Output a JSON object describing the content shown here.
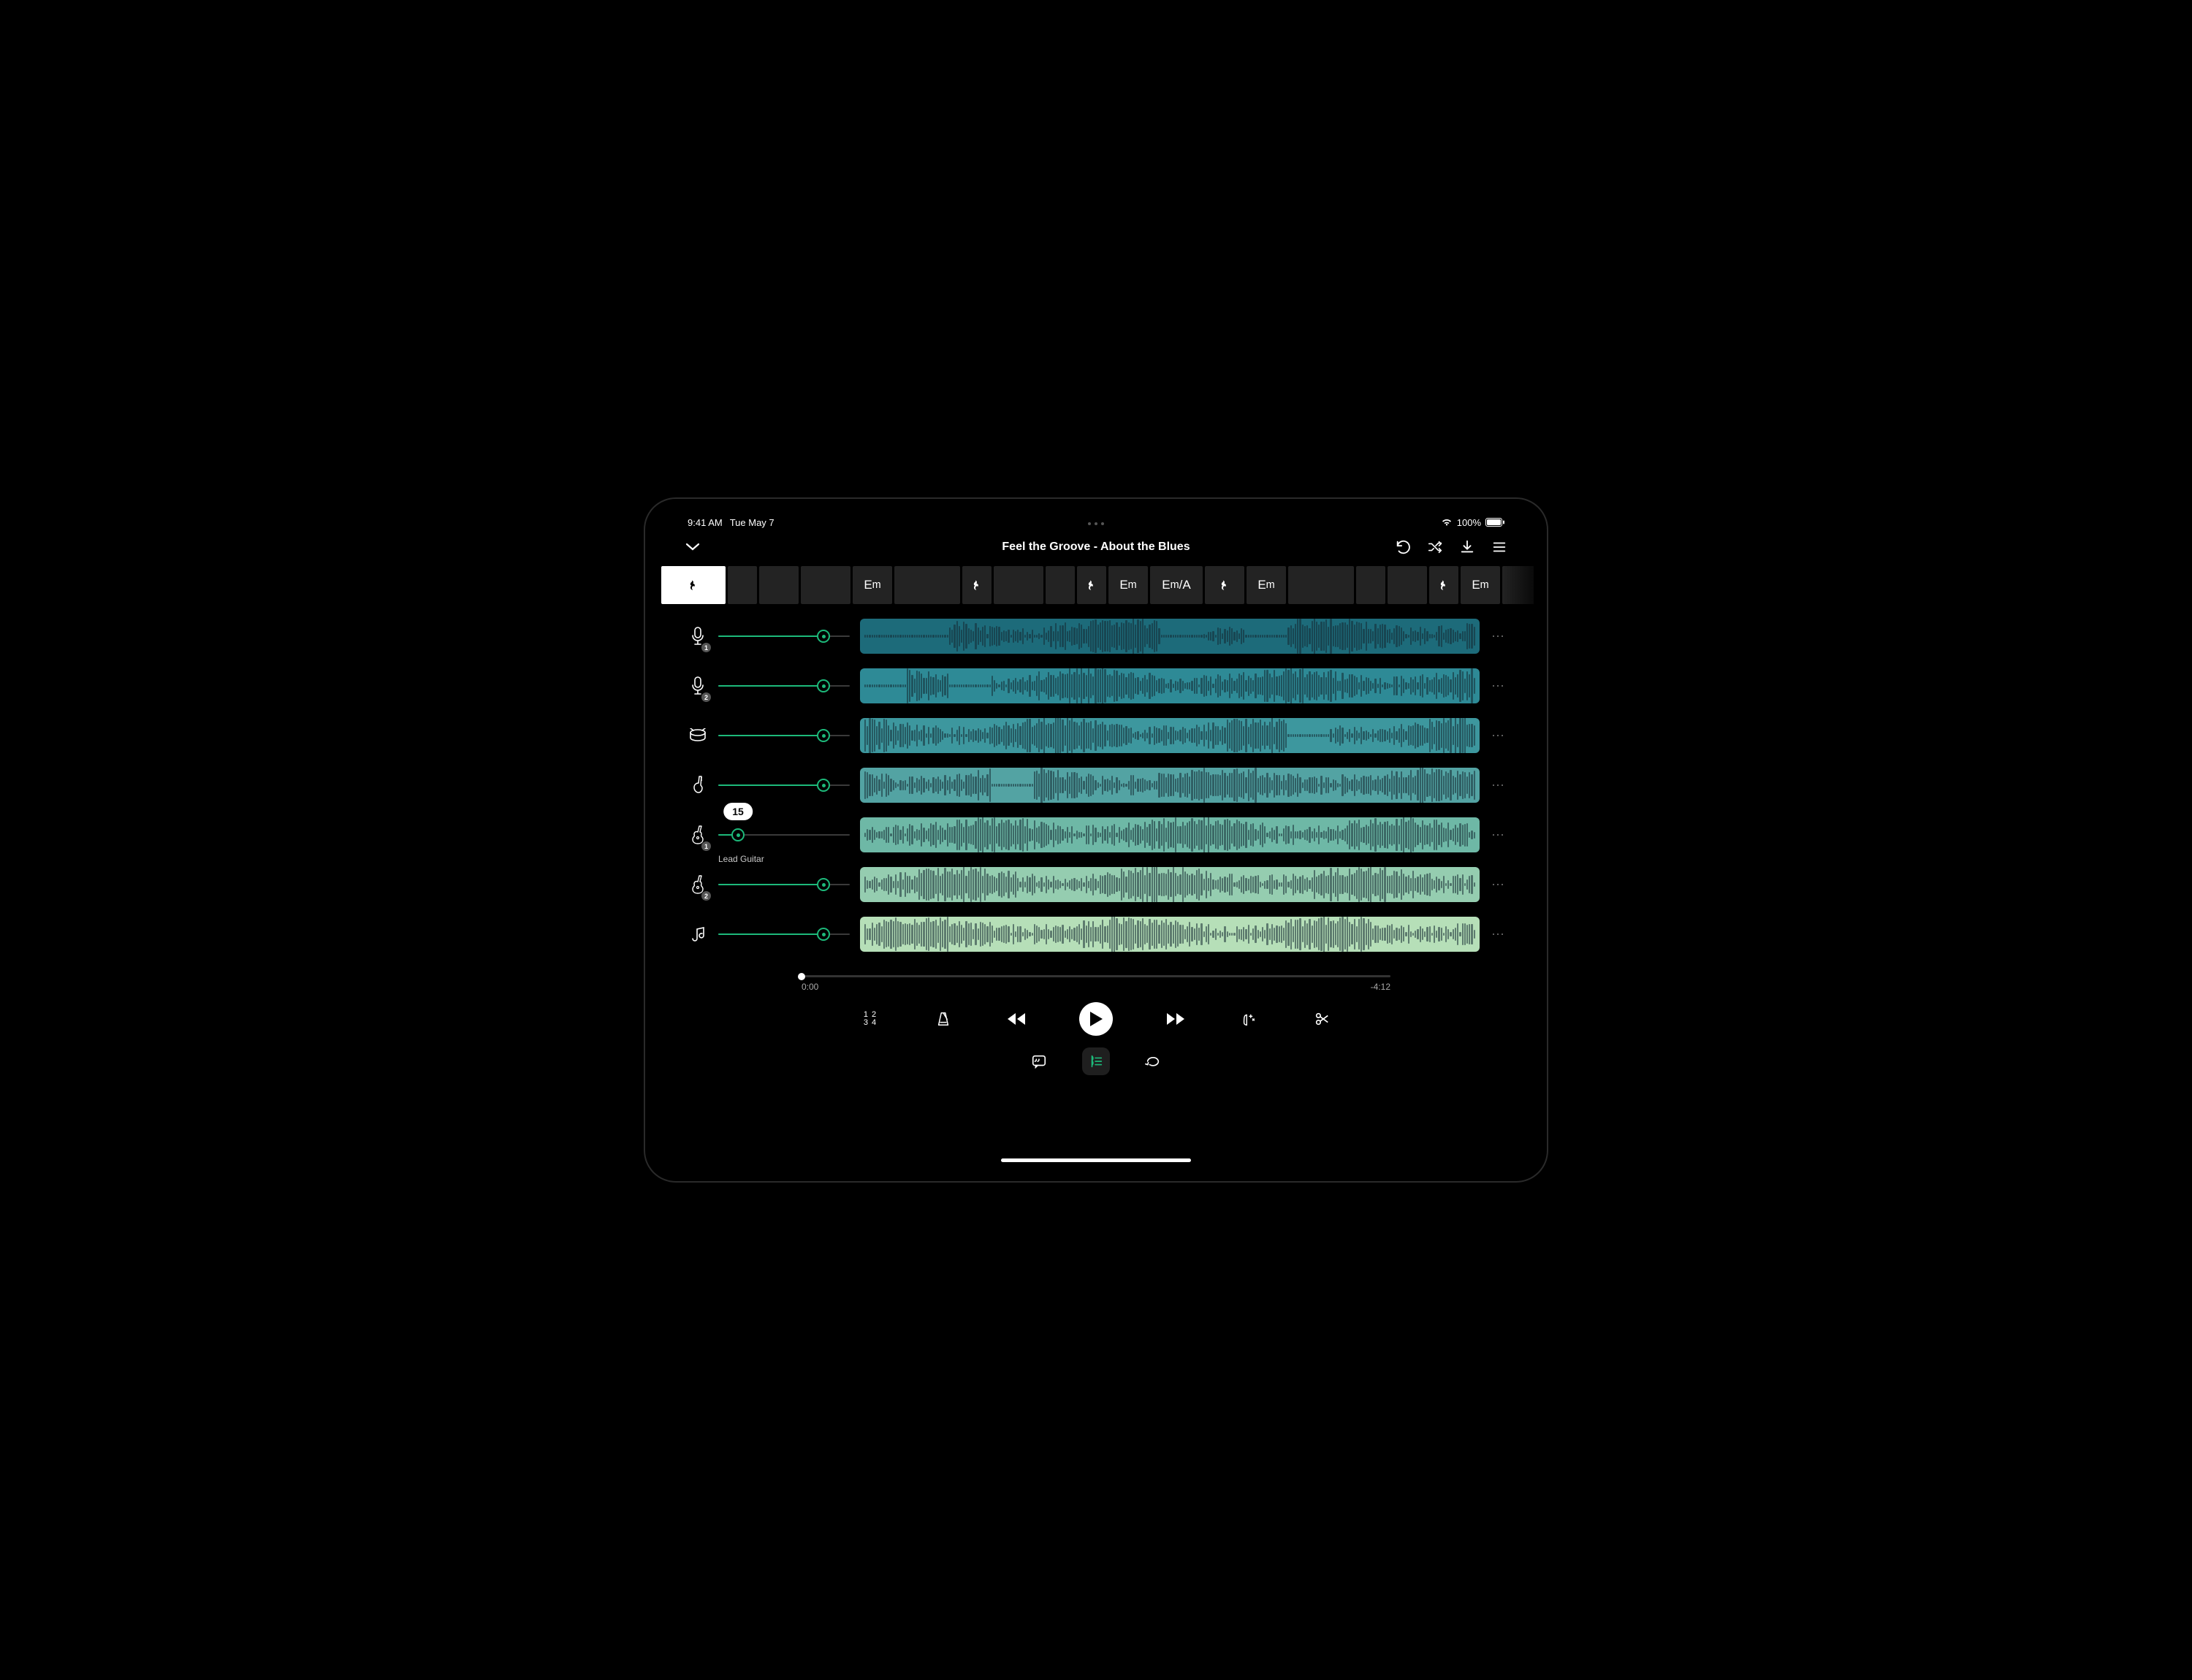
{
  "status": {
    "time": "9:41 AM",
    "date": "Tue May 7",
    "battery": "100%"
  },
  "header": {
    "title": "Feel the Groove - About the Blues"
  },
  "chords": [
    {
      "label": "",
      "type": "rest",
      "active": true,
      "w": 88
    },
    {
      "label": "",
      "type": "blank",
      "w": 26
    },
    {
      "label": "",
      "type": "blank",
      "w": 54
    },
    {
      "label": "",
      "type": "blank",
      "w": 68
    },
    {
      "label": "Em",
      "type": "chord",
      "w": 54
    },
    {
      "label": "",
      "type": "blank",
      "w": 90
    },
    {
      "label": "",
      "type": "rest",
      "w": 26
    },
    {
      "label": "",
      "type": "blank",
      "w": 68
    },
    {
      "label": "",
      "type": "blank",
      "w": 26
    },
    {
      "label": "",
      "type": "rest",
      "w": 40
    },
    {
      "label": "Em",
      "type": "chord",
      "w": 54
    },
    {
      "label": "Em/A",
      "type": "chord",
      "w": 72
    },
    {
      "label": "",
      "type": "rest",
      "w": 54
    },
    {
      "label": "Em",
      "type": "chord",
      "w": 54
    },
    {
      "label": "",
      "type": "blank",
      "w": 90
    },
    {
      "label": "",
      "type": "blank",
      "w": 26
    },
    {
      "label": "",
      "type": "blank",
      "w": 54
    },
    {
      "label": "",
      "type": "rest",
      "w": 40
    },
    {
      "label": "Em",
      "type": "chord",
      "w": 54
    },
    {
      "label": "",
      "type": "fade",
      "w": 60
    }
  ],
  "tracks": [
    {
      "icon": "mic",
      "badge": "1",
      "volume": 80,
      "color": "#1d6b7a",
      "label": ""
    },
    {
      "icon": "mic",
      "badge": "2",
      "volume": 80,
      "color": "#2e8a96",
      "label": ""
    },
    {
      "icon": "drums",
      "badge": "",
      "volume": 80,
      "color": "#3d979e",
      "label": ""
    },
    {
      "icon": "bass",
      "badge": "",
      "volume": 80,
      "color": "#53a3a3",
      "label": ""
    },
    {
      "icon": "guitar",
      "badge": "1",
      "volume": 15,
      "color": "#6eb8a6",
      "label": "Lead Guitar",
      "tooltip": "15"
    },
    {
      "icon": "guitar",
      "badge": "2",
      "volume": 80,
      "color": "#95cdb0",
      "label": ""
    },
    {
      "icon": "keys",
      "badge": "",
      "volume": 80,
      "color": "#b6dfb8",
      "label": ""
    }
  ],
  "transport": {
    "position": "0:00",
    "remaining": "-4:12",
    "countin": "1 2\n3 4"
  }
}
